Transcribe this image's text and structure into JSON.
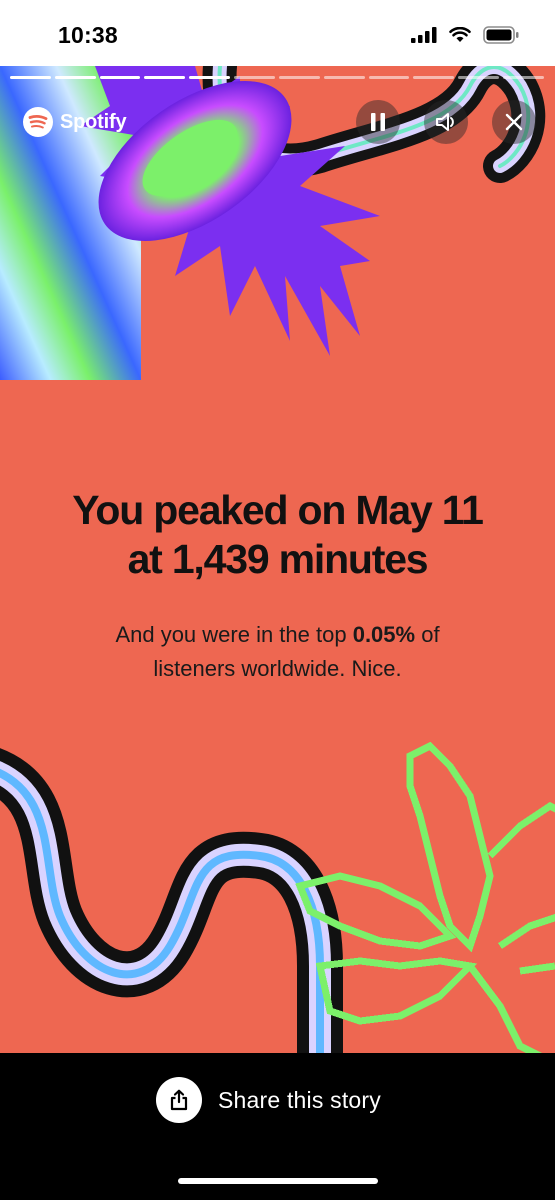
{
  "status_bar": {
    "time": "10:38",
    "icons": [
      "cellular-signal-icon",
      "wifi-icon",
      "battery-icon"
    ]
  },
  "story": {
    "background_color": "#EE6751",
    "progress_segments_total": 12,
    "progress_segments_done": 5,
    "brand": "Spotify",
    "controls": [
      "pause-icon",
      "speaker-icon",
      "close-icon"
    ],
    "headline_line1": "You peaked on May 11",
    "headline_line2": "at 1,439 minutes",
    "subtext_before": "And you were in the top ",
    "subtext_highlight": "0.05%",
    "subtext_after": " of",
    "subtext_line2": "listeners worldwide. Nice."
  },
  "share": {
    "label": "Share this story",
    "icon": "share-icon"
  },
  "colors": {
    "card": "#EE6751",
    "accent_green": "#7CF06A",
    "accent_purple": "#8A2BE2",
    "bottom_bar": "#000000"
  }
}
